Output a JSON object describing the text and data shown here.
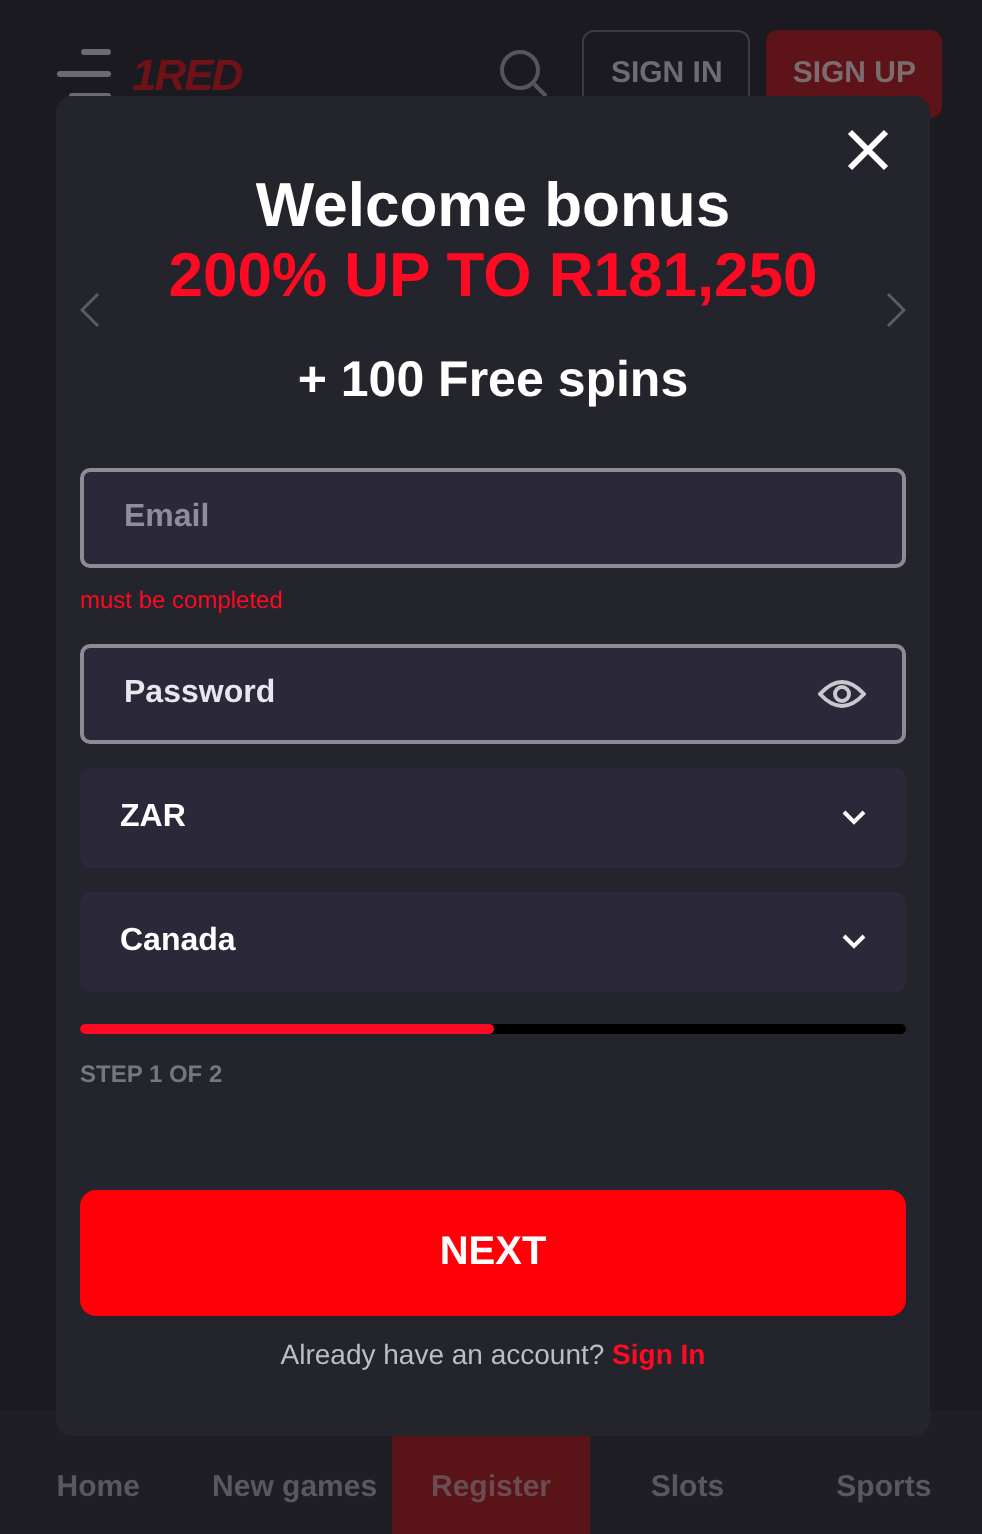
{
  "header": {
    "logo": "1RED",
    "sign_in": "SIGN IN",
    "sign_up": "SIGN UP"
  },
  "modal": {
    "title": "Welcome bonus",
    "offer": "200% UP TO R181,250",
    "extra": "+ 100 Free spins",
    "fields": [
      {
        "kind": "text",
        "placeholder": "Email",
        "error": "must be completed"
      },
      {
        "kind": "password",
        "placeholder": "Password"
      },
      {
        "kind": "select",
        "value": "ZAR"
      },
      {
        "kind": "select",
        "value": "Canada"
      }
    ],
    "progress": {
      "level": 0.5
    },
    "step": "STEP 1 OF 2",
    "button": "NEXT",
    "footer": {
      "text": "Already have an account?",
      "link": "Sign In"
    }
  },
  "bottom_nav": [
    {
      "label": "Home",
      "selected": false
    },
    {
      "label": "New games",
      "selected": false
    },
    {
      "label": "Register",
      "selected": true
    },
    {
      "label": "Slots",
      "selected": false
    },
    {
      "label": "Sports",
      "selected": false
    }
  ]
}
